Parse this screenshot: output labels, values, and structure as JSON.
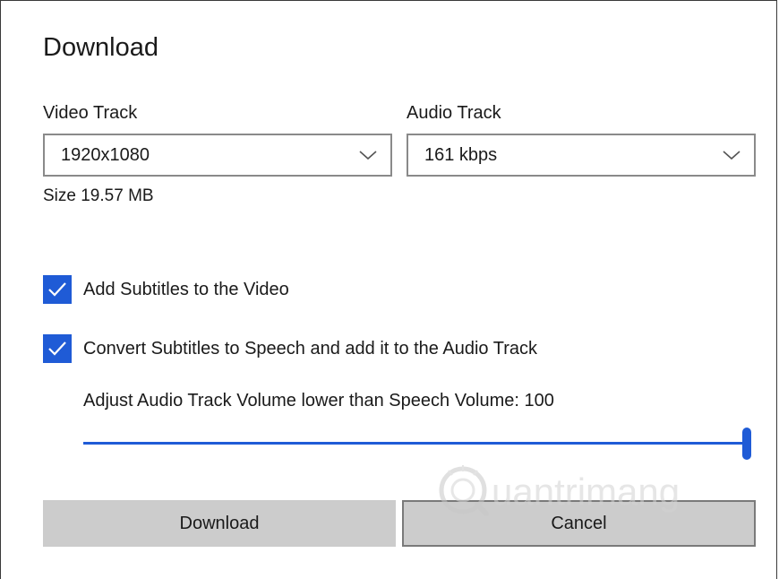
{
  "dialog": {
    "title": "Download"
  },
  "video_track": {
    "label": "Video Track",
    "selected": "1920x1080"
  },
  "audio_track": {
    "label": "Audio Track",
    "selected": "161 kbps"
  },
  "size": {
    "text": "Size 19.57 MB"
  },
  "options": {
    "add_subtitles": {
      "label": "Add Subtitles to the Video",
      "checked": true
    },
    "convert_speech": {
      "label": "Convert Subtitles to Speech and add it to the Audio Track",
      "checked": true
    }
  },
  "volume": {
    "label": "Adjust Audio Track Volume lower than Speech Volume: 100",
    "value": 100,
    "max": 100
  },
  "buttons": {
    "download": "Download",
    "cancel": "Cancel"
  },
  "watermark": {
    "text": "uantrimang"
  },
  "colors": {
    "accent": "#1f5bd6",
    "button_bg": "#cccccc"
  }
}
